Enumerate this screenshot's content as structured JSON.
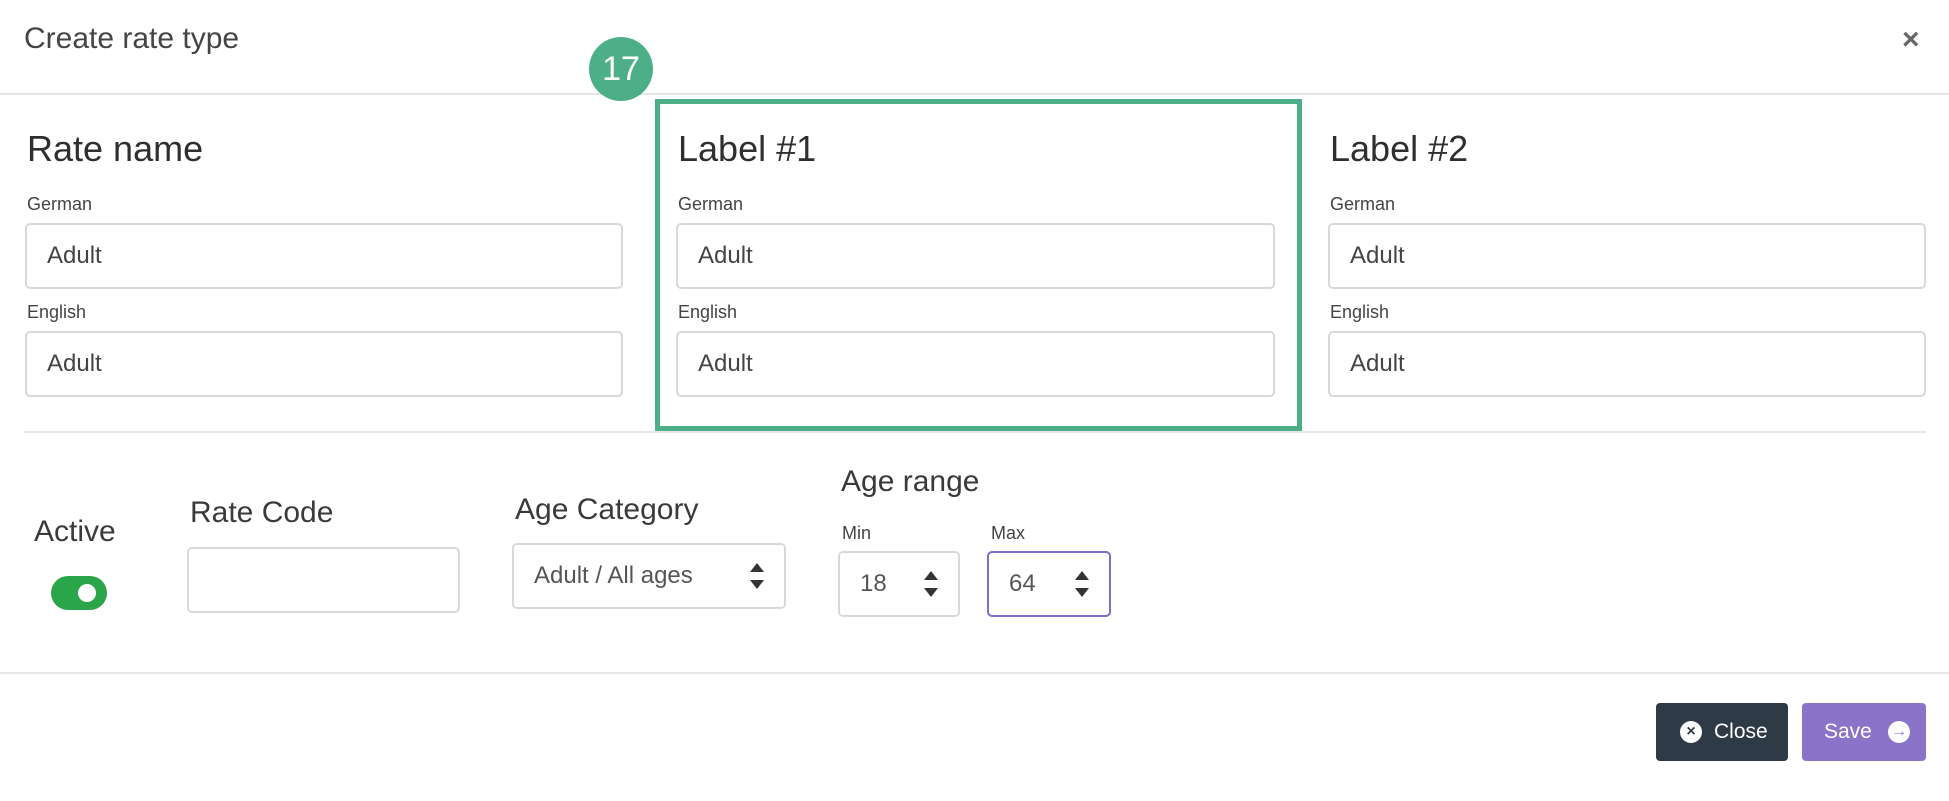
{
  "modal": {
    "title": "Create rate type",
    "close_symbol": "×"
  },
  "annotation": {
    "badge": "17",
    "highlight_color": "#4caf88"
  },
  "columns": [
    {
      "title": "Rate name",
      "german_label": "German",
      "german_value": "Adult",
      "english_label": "English",
      "english_value": "Adult"
    },
    {
      "title": "Label #1",
      "german_label": "German",
      "german_value": "Adult",
      "english_label": "English",
      "english_value": "Adult"
    },
    {
      "title": "Label #2",
      "german_label": "German",
      "german_value": "Adult",
      "english_label": "English",
      "english_value": "Adult"
    }
  ],
  "settings": {
    "active_label": "Active",
    "active_on": true,
    "rate_code_label": "Rate Code",
    "rate_code_value": "",
    "age_category_label": "Age Category",
    "age_category_value": "Adult / All ages",
    "age_range_label": "Age range",
    "min_label": "Min",
    "min_value": "18",
    "max_label": "Max",
    "max_value": "64"
  },
  "footer": {
    "close_label": "Close",
    "close_icon": "close-circle-icon",
    "save_label": "Save",
    "save_icon": "arrow-right-circle-icon"
  },
  "colors": {
    "toggle_on": "#2aa54a",
    "close_button": "#2e3a46",
    "save_button": "#8a73c9",
    "focus_border": "#7b6fd0"
  }
}
